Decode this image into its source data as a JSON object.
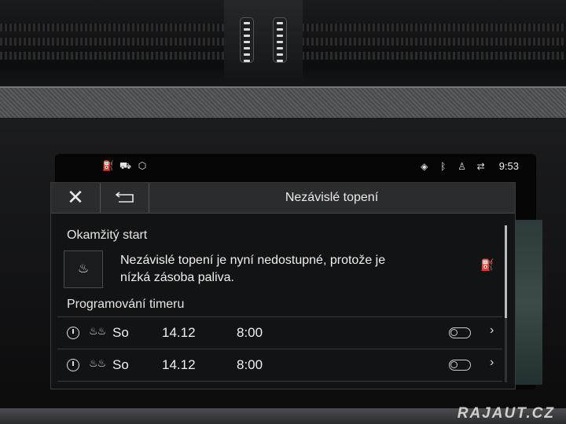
{
  "statusbar": {
    "time": "9:53",
    "left_icons": [
      "fuel-icon",
      "car-icon",
      "cube-icon"
    ],
    "right_icons": [
      "location-icon",
      "bluetooth-icon",
      "person-icon",
      "signal-icon"
    ]
  },
  "panel": {
    "close_label": "✕",
    "title": "Nezávislé topení",
    "instant_start": {
      "heading": "Okamžitý start",
      "message_line1": "Nezávislé topení je nyní nedostupné, protože je",
      "message_line2": "nízká zásoba paliva."
    },
    "timer": {
      "heading": "Programování timeru",
      "rows": [
        {
          "day": "So",
          "date": "14.12",
          "time": "8:00",
          "enabled": false
        },
        {
          "day": "So",
          "date": "14.12",
          "time": "8:00",
          "enabled": false
        }
      ]
    }
  },
  "watermark": "RAJAUT.CZ"
}
